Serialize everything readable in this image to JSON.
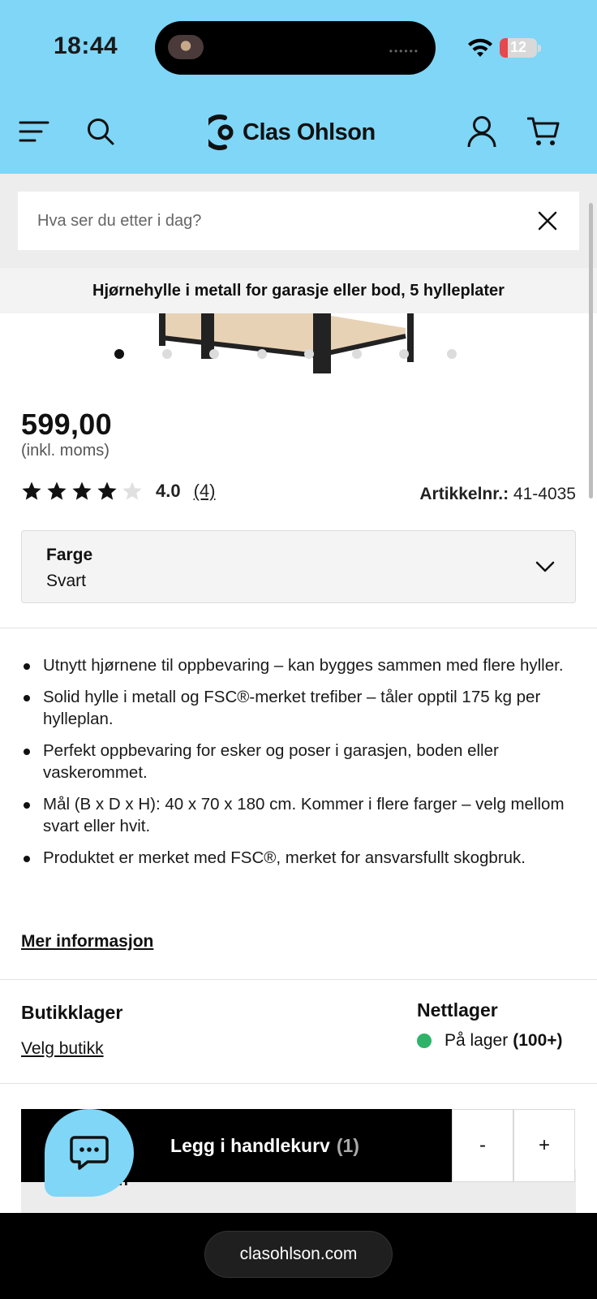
{
  "status_bar": {
    "time": "18:44",
    "battery": "12"
  },
  "header": {
    "brand": "Clas Ohlson"
  },
  "search": {
    "placeholder": "Hva ser du etter i dag?"
  },
  "product": {
    "title": "Hjørnehylle i metall for garasje eller bod, 5 hylleplater",
    "price": "599,00",
    "vat_note": "(inkl. moms)",
    "rating": "4.0",
    "rating_fraction": 0.8,
    "review_count": "(4)",
    "article_label": "Artikkelnr.:",
    "article_number": "41-4035",
    "image_count": 8,
    "active_image": 1
  },
  "color_select": {
    "label": "Farge",
    "value": "Svart"
  },
  "features": [
    "Utnytt hjørnene til oppbevaring – kan bygges sammen med flere hyller.",
    "Solid hylle i metall og FSC®-merket trefiber – tåler opptil 175 kg per hylleplan.",
    "Perfekt oppbevaring for esker og poser i garasjen, boden eller vaskerommet.",
    "Mål (B x D x H): 40 x 70 x 180 cm. Kommer i flere farger – velg mellom svart eller hvit.",
    "Produktet er merket med FSC®, merket for ansvarsfullt skogbruk."
  ],
  "more_info": "Mer informasjon",
  "stock": {
    "store_title": "Butikklager",
    "store_link": "Velg butikk",
    "online_title": "Nettlager",
    "online_status": "På lager",
    "online_count": "(100+)"
  },
  "behind_text": "masjon",
  "cart": {
    "label": "Legg i handlekurv",
    "count": "(1)",
    "minus": "-",
    "plus": "+"
  },
  "browser": {
    "url": "clasohlson.com"
  },
  "colors": {
    "header_bg": "#7fd6f7",
    "in_stock": "#2fb36a",
    "cart_bg": "#000000"
  }
}
